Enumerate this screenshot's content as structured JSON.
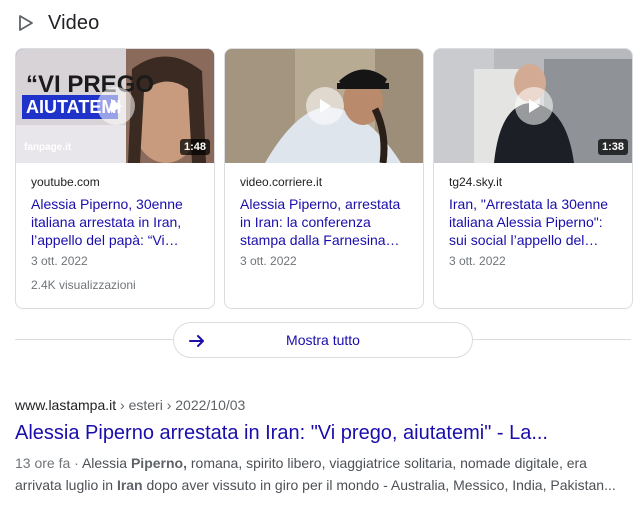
{
  "section": {
    "title": "Video"
  },
  "videos": [
    {
      "source": "youtube.com",
      "title": "Alessia Piperno, 30enne italiana arrestata in Iran, l’appello del papà: “Vi prego, aiutatemi”",
      "date": "3 ott. 2022",
      "views": "2.4K visualizzazioni",
      "duration": "1:48",
      "thumb_text_1": "“VI PREGO",
      "thumb_text_2": "AIUTATEMI",
      "thumb_logo": "fanpage.it"
    },
    {
      "source": "video.corriere.it",
      "title": "Alessia Piperno, arrestata in Iran: la conferenza stampa dalla Farnesina dei genitori",
      "date": "3 ott. 2022"
    },
    {
      "source": "tg24.sky.it",
      "title": "Iran, \"Arrestata la 30enne italiana Alessia Piperno\": sui social l’appello del padre",
      "date": "3 ott. 2022",
      "duration": "1:38"
    }
  ],
  "show_all": {
    "label": "Mostra tutto"
  },
  "result": {
    "domain": "www.lastampa.it",
    "path": " › esteri › 2022/10/03",
    "title": "Alessia Piperno arrestata in Iran: \"Vi prego, aiutatemi\" - La...",
    "age": "13 ore fa",
    "separator": " · ",
    "s1": "Alessia ",
    "s1_bold": "Piperno,",
    "s2": " romana, spirito libero, viaggiatrice solitaria, nomade digitale, era arrivata luglio in ",
    "s2_bold": "Iran",
    "s3": " dopo aver vissuto in giro per il mondo - Australia, Messico, India, Pakistan..."
  },
  "colors": {
    "link": "#1a0dab",
    "text": "#202124",
    "muted": "#70757a",
    "border": "#dadce0"
  }
}
